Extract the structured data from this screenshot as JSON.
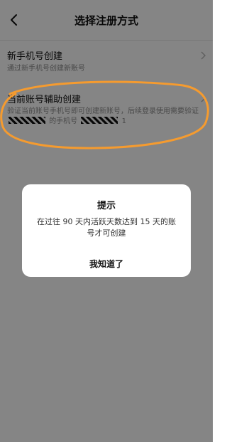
{
  "nav": {
    "back_icon": "chevron-left-icon",
    "title": "选择注册方式"
  },
  "options": [
    {
      "title": "新手机号创建",
      "desc": "通过新手机号创建新账号",
      "icon": "chevron-right-icon"
    },
    {
      "title": "当前账号辅助创建",
      "desc_1": "验证当前账号手机号即可创建新账号，后续登录使用需要验证",
      "desc_2": "的手机号",
      "desc_end": "1",
      "icon": "chevron-right-icon"
    }
  ],
  "dialog": {
    "title": "提示",
    "message": "在过往 90 天内活跃天数达到 15 天的账号才可创建",
    "button": "我知道了"
  },
  "colors": {
    "annotation": "#f59b2f",
    "overlay": "rgba(0,0,0,0.48)",
    "muted_text": "#8c8c8c"
  }
}
